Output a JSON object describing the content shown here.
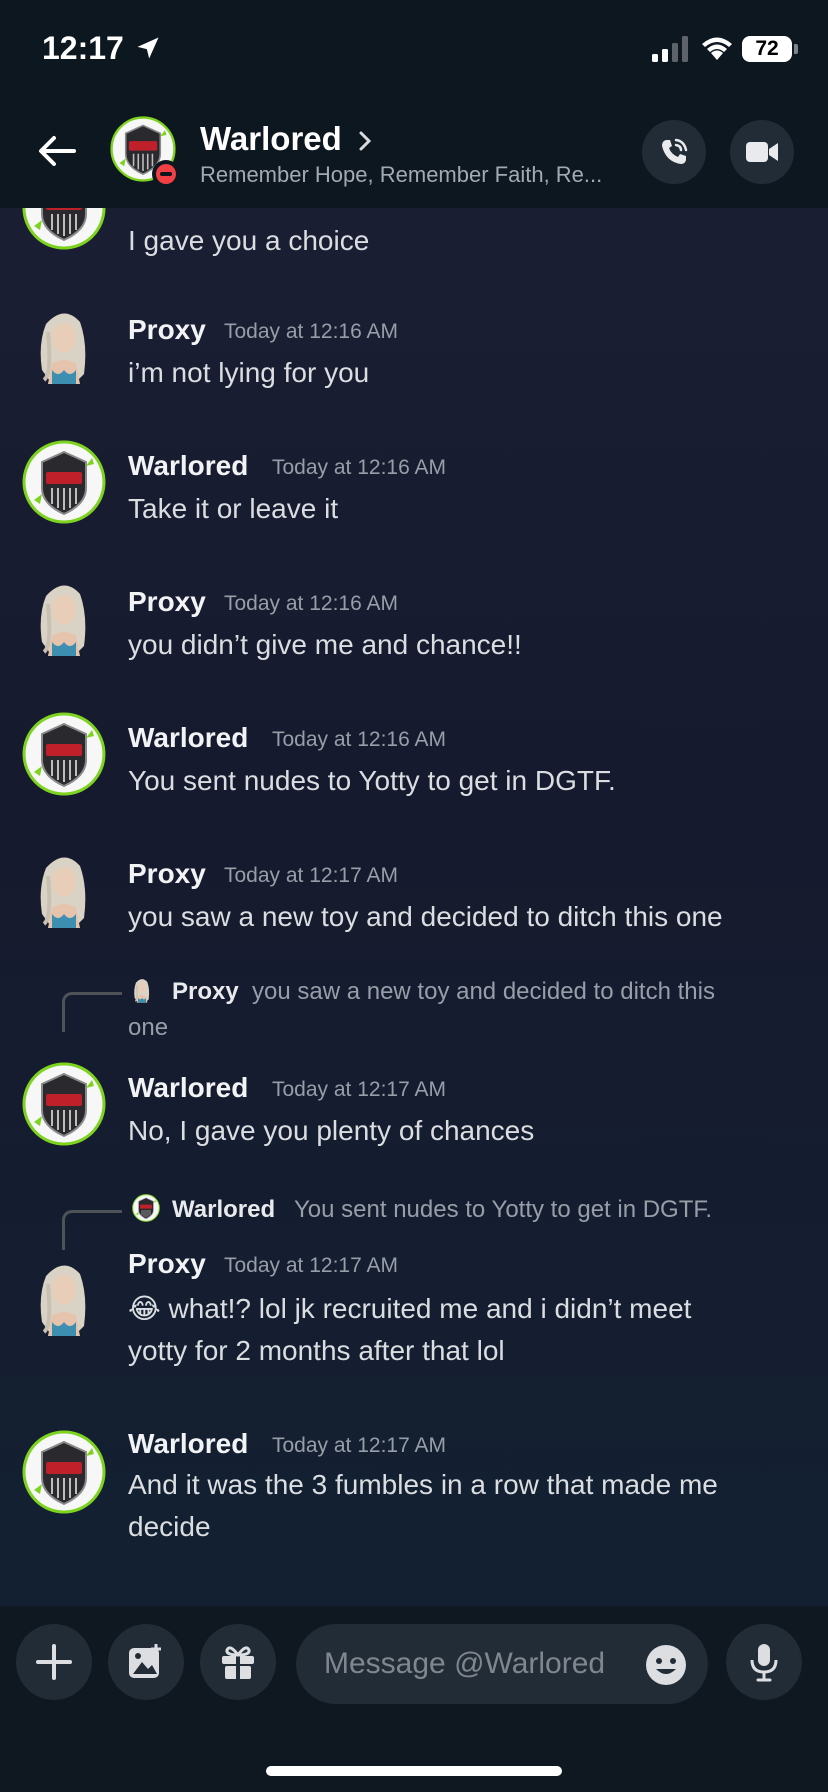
{
  "status_bar": {
    "time": "12:17",
    "battery": "72"
  },
  "header": {
    "name": "Warlored",
    "status": "Remember Hope, Remember Faith, Re..."
  },
  "messages": [
    {
      "author": "",
      "time": "",
      "content": "I gave you a choice"
    },
    {
      "author": "Proxy",
      "time": "Today at 12:16 AM",
      "content": "i’m not lying for you"
    },
    {
      "author": "Warlored",
      "time": "Today at 12:16 AM",
      "content": "Take it or leave it"
    },
    {
      "author": "Proxy",
      "time": "Today at 12:16 AM",
      "content": "you didn’t give me and chance!!"
    },
    {
      "author": "Warlored",
      "time": "Today at 12:16 AM",
      "content": "You sent nudes to Yotty to get in DGTF."
    },
    {
      "author": "Proxy",
      "time": "Today at 12:17 AM",
      "content": "you saw a new toy and decided to ditch this one"
    },
    {
      "author": "Warlored",
      "time": "Today at 12:17 AM",
      "content": "No, I gave you plenty of chances",
      "reply": {
        "author": "Proxy",
        "text_line1": "you saw a new toy and decided to ditch this",
        "text_line2": "one"
      }
    },
    {
      "author": "Proxy",
      "time": "Today at 12:17 AM",
      "emoji": "😂",
      "content_line1": "what!? lol jk recruited me and i didn’t meet",
      "content_line2": "yotty for 2 months after that lol",
      "reply": {
        "author": "Warlored",
        "text": "You sent nudes to Yotty to get in DGTF."
      }
    },
    {
      "author": "Warlored",
      "time": "Today at 12:17 AM",
      "content_line1": "And it was the 3 fumbles in a row that made me",
      "content_line2": "decide"
    }
  ],
  "composer": {
    "placeholder": "Message @Warlored"
  },
  "icons": {
    "back": "arrow-left-icon",
    "call": "phone-call-icon",
    "video": "video-camera-icon",
    "plus": "plus-icon",
    "image": "image-icon",
    "gift": "gift-icon",
    "emoji": "emoji-icon",
    "mic": "microphone-icon"
  },
  "colors": {
    "background": "#1c2034",
    "header": "#0d1720",
    "dnd": "#f23f43",
    "avatar_ring": "#7ed321"
  }
}
